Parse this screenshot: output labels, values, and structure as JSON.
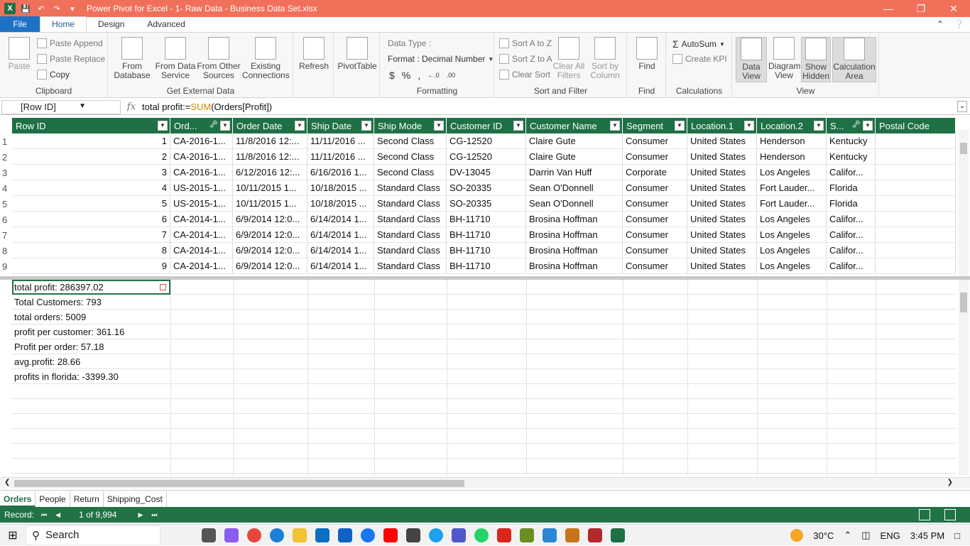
{
  "window": {
    "title": "Power Pivot for Excel - 1- Raw Data - Business Data Set.xlsx",
    "controls": [
      "minimize",
      "restore",
      "close"
    ]
  },
  "menu": {
    "tabs": [
      "File",
      "Home",
      "Design",
      "Advanced"
    ],
    "active_tab": "Home"
  },
  "ribbon": {
    "clipboard": {
      "label": "Clipboard",
      "paste": "Paste",
      "paste_append": "Paste Append",
      "paste_replace": "Paste Replace",
      "copy": "Copy"
    },
    "external": {
      "label": "Get External Data",
      "from_database": "From\nDatabase",
      "from_data_service": "From Data\nService",
      "from_other_sources": "From Other\nSources",
      "existing_connections": "Existing\nConnections"
    },
    "refresh": {
      "label": "Refresh"
    },
    "pivottable": {
      "label": "PivotTable"
    },
    "formatting": {
      "label": "Formatting",
      "data_type": "Data Type :",
      "format": "Format : Decimal Number",
      "currency": "$",
      "percent": "%",
      "comma": ",",
      "inc_decimals": "←.0",
      "dec_decimals": ".00"
    },
    "sort_filter": {
      "label": "Sort and Filter",
      "sort_az": "Sort A to Z",
      "sort_za": "Sort Z to A",
      "clear_sort": "Clear Sort",
      "clear_all_filters": "Clear All\nFilters",
      "sort_by_column": "Sort by\nColumn"
    },
    "find": {
      "label": "Find",
      "find": "Find"
    },
    "calculations": {
      "label": "Calculations",
      "autosum": "AutoSum",
      "create_kpi": "Create KPI"
    },
    "view": {
      "label": "View",
      "data_view": "Data\nView",
      "diagram_view": "Diagram\nView",
      "show_hidden": "Show\nHidden",
      "calculation_area": "Calculation\nArea"
    }
  },
  "formula_bar": {
    "name_box": "[Row ID]",
    "fx": "fx",
    "formula_prefix": "total profit:=",
    "formula_fn": "SUM",
    "formula_suffix": "(Orders[Profit])"
  },
  "table": {
    "columns": [
      "Row ID",
      "Ord...",
      "Order Date",
      "Ship Date",
      "Ship Mode",
      "Customer ID",
      "Customer Name",
      "Segment",
      "Location.1",
      "Location.2",
      "S...",
      "Postal Code"
    ],
    "rows": [
      [
        "1",
        "CA-2016-1...",
        "11/8/2016 12:...",
        "11/11/2016 ...",
        "Second Class",
        "CG-12520",
        "Claire Gute",
        "Consumer",
        "United States",
        "Henderson",
        "Kentucky",
        ""
      ],
      [
        "2",
        "CA-2016-1...",
        "11/8/2016 12:...",
        "11/11/2016 ...",
        "Second Class",
        "CG-12520",
        "Claire Gute",
        "Consumer",
        "United States",
        "Henderson",
        "Kentucky",
        ""
      ],
      [
        "3",
        "CA-2016-1...",
        "6/12/2016 12:...",
        "6/16/2016 1...",
        "Second Class",
        "DV-13045",
        "Darrin Van Huff",
        "Corporate",
        "United States",
        "Los Angeles",
        "Califor...",
        ""
      ],
      [
        "4",
        "US-2015-1...",
        "10/11/2015 1...",
        "10/18/2015 ...",
        "Standard Class",
        "SO-20335",
        "Sean O'Donnell",
        "Consumer",
        "United States",
        "Fort Lauder...",
        "Florida",
        ""
      ],
      [
        "5",
        "US-2015-1...",
        "10/11/2015 1...",
        "10/18/2015 ...",
        "Standard Class",
        "SO-20335",
        "Sean O'Donnell",
        "Consumer",
        "United States",
        "Fort Lauder...",
        "Florida",
        ""
      ],
      [
        "6",
        "CA-2014-1...",
        "6/9/2014 12:0...",
        "6/14/2014 1...",
        "Standard Class",
        "BH-11710",
        "Brosina Hoffman",
        "Consumer",
        "United States",
        "Los Angeles",
        "Califor...",
        ""
      ],
      [
        "7",
        "CA-2014-1...",
        "6/9/2014 12:0...",
        "6/14/2014 1...",
        "Standard Class",
        "BH-11710",
        "Brosina Hoffman",
        "Consumer",
        "United States",
        "Los Angeles",
        "Califor...",
        ""
      ],
      [
        "8",
        "CA-2014-1...",
        "6/9/2014 12:0...",
        "6/14/2014 1...",
        "Standard Class",
        "BH-11710",
        "Brosina Hoffman",
        "Consumer",
        "United States",
        "Los Angeles",
        "Califor...",
        ""
      ],
      [
        "9",
        "CA-2014-1...",
        "6/9/2014 12:0...",
        "6/14/2014 1...",
        "Standard Class",
        "BH-11710",
        "Brosina Hoffman",
        "Consumer",
        "United States",
        "Los Angeles",
        "Califor...",
        ""
      ]
    ]
  },
  "measures": [
    "total profit: 286397.02",
    "Total Customers: 793",
    "total orders: 5009",
    "profit per customer: 361.16",
    "Profit per order: 57.18",
    "avg.profit: 28.66",
    "profits in florida: -3399.30"
  ],
  "sheet_tabs": [
    "Orders",
    "People",
    "Return",
    "Shipping_Cost"
  ],
  "active_sheet": "Orders",
  "status": {
    "record_label": "Record:",
    "record_count": "1 of 9,994"
  },
  "taskbar": {
    "search": "Search",
    "weather": "30°C",
    "language": "ENG",
    "time": "3:45 PM"
  },
  "colors": {
    "accent": "#217346",
    "titlebar": "#f0705a",
    "file_tab": "#1e72c5"
  }
}
